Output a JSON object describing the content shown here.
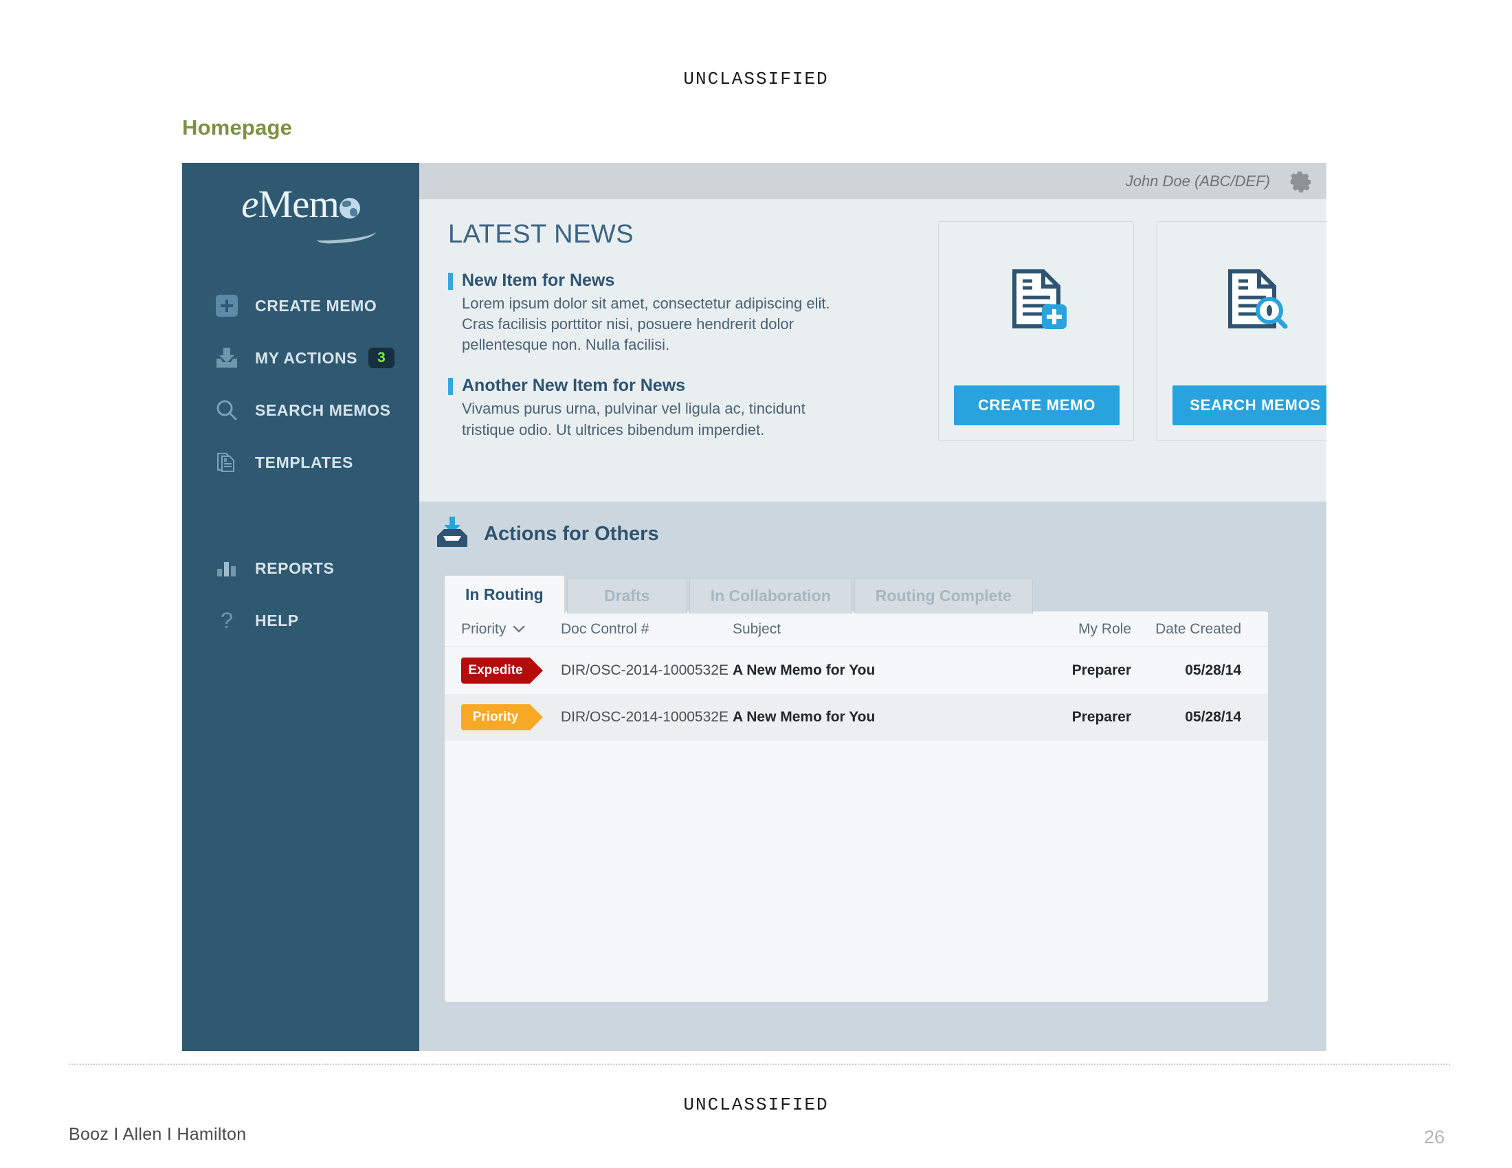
{
  "slide": {
    "classification_top": "UNCLASSIFIED",
    "classification_bottom": "UNCLASSIFIED",
    "title": "Homepage",
    "footer_brand": "Booz I Allen I Hamilton",
    "page_number": "26",
    "title_color": "#7b9144"
  },
  "app": {
    "logo": {
      "text_left": "e",
      "text_right": "Mem",
      "globe_icon": "globe-icon"
    },
    "topbar": {
      "user": "John Doe (ABC/DEF)",
      "settings_icon": "gear-icon"
    },
    "sidebar": {
      "items": [
        {
          "label": "CREATE MEMO",
          "icon": "plus-square-icon",
          "badge": null
        },
        {
          "label": "MY ACTIONS",
          "icon": "inbox-down-icon",
          "badge": "3"
        },
        {
          "label": "SEARCH MEMOS",
          "icon": "search-icon",
          "badge": null
        },
        {
          "label": "TEMPLATES",
          "icon": "documents-stack-icon",
          "badge": null
        },
        {
          "label": "REPORTS",
          "icon": "bar-chart-icon",
          "badge": null
        },
        {
          "label": "HELP",
          "icon": "question-mark-icon",
          "badge": null
        }
      ],
      "badge_text_color": "#7ced2e",
      "background": "#2f5871"
    },
    "news": {
      "heading": "LATEST NEWS",
      "items": [
        {
          "title": "New Item for News",
          "body": "Lorem ipsum dolor sit amet, consectetur adipiscing elit. Cras facilisis porttitor nisi, posuere hendrerit dolor pellentesque non. Nulla facilisi."
        },
        {
          "title": "Another New Item for News",
          "body": "Vivamus purus urna, pulvinar vel ligula ac, tincidunt tristique odio. Ut ultrices bibendum imperdiet."
        }
      ],
      "accent_color": "#33a7e0"
    },
    "cards": [
      {
        "icon": "document-add-icon",
        "button_label": "CREATE MEMO"
      },
      {
        "icon": "document-search-icon",
        "button_label": "SEARCH MEMOS"
      }
    ],
    "actions_section": {
      "heading": "Actions for Others",
      "icon": "outbox-up-icon",
      "tabs": [
        {
          "label": "In Routing",
          "active": true
        },
        {
          "label": "Drafts",
          "active": false
        },
        {
          "label": "In Collaboration",
          "active": false
        },
        {
          "label": "Routing Complete",
          "active": false
        }
      ],
      "table": {
        "columns": [
          "Priority",
          "Doc Control #",
          "Subject",
          "My Role",
          "Date Created"
        ],
        "sort_column": "Priority",
        "rows": [
          {
            "priority": "Expedite",
            "priority_color": "#b50b0b",
            "doc_control": "DIR/OSC-2014-1000532E",
            "subject": "A New Memo for You",
            "my_role": "Preparer",
            "date_created": "05/28/14"
          },
          {
            "priority": "Priority",
            "priority_color": "#f9a825",
            "doc_control": "DIR/OSC-2014-1000532E",
            "subject": "A New Memo for You",
            "my_role": "Preparer",
            "date_created": "05/28/14"
          }
        ]
      }
    },
    "accent_blue": "#28a3dd"
  }
}
